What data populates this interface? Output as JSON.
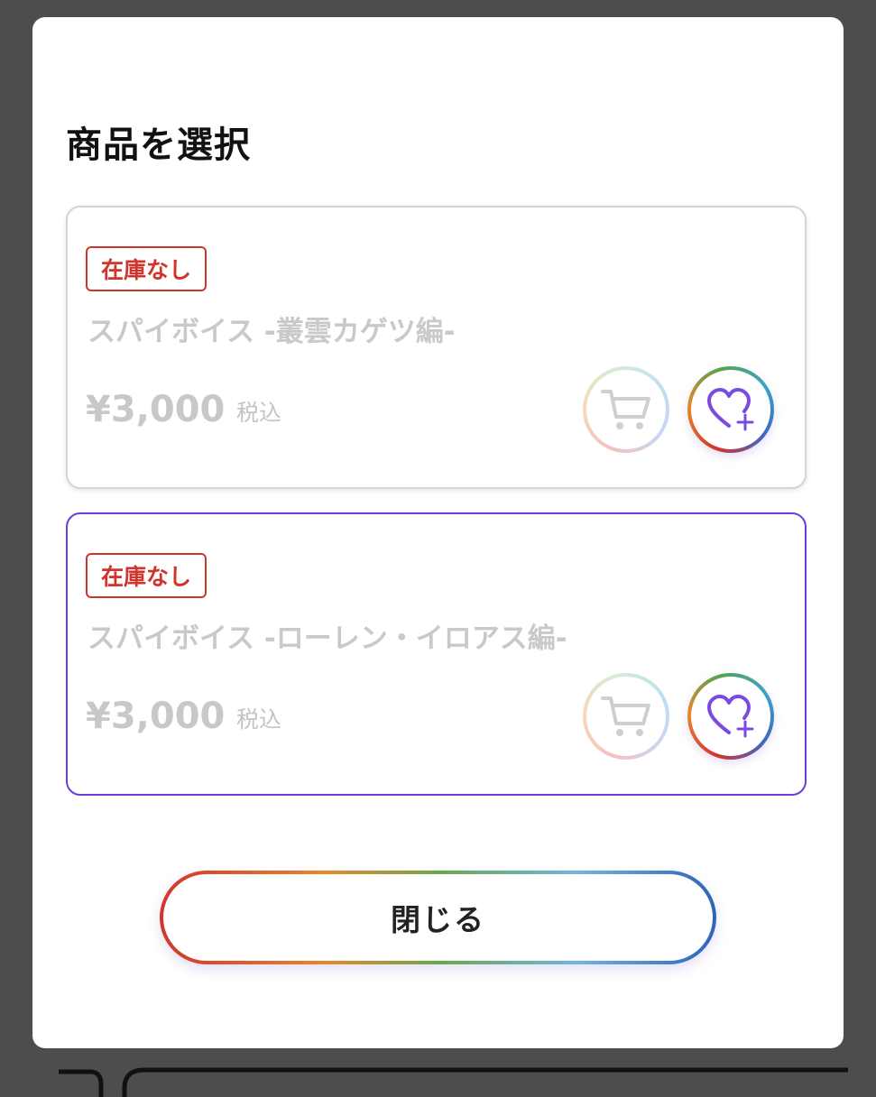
{
  "modal": {
    "title": "商品を選択",
    "close_label": "閉じる"
  },
  "products": [
    {
      "stock_badge": "在庫なし",
      "name": "スパイボイス -叢雲カゲツ編-",
      "price": "¥3,000",
      "tax_label": "税込",
      "selected": false,
      "cart_icon": "cart-icon",
      "favorite_icon": "heart-plus-icon"
    },
    {
      "stock_badge": "在庫なし",
      "name": "スパイボイス -ローレン・イロアス編-",
      "price": "¥3,000",
      "tax_label": "税込",
      "selected": true,
      "cart_icon": "cart-icon",
      "favorite_icon": "heart-plus-icon"
    }
  ],
  "colors": {
    "overlay": "#4d4d4d",
    "badge_red": "#d2342d",
    "selected_border": "#6a3ddb",
    "heart_purple": "#7a4be0",
    "disabled_text": "#c8c8c8"
  }
}
